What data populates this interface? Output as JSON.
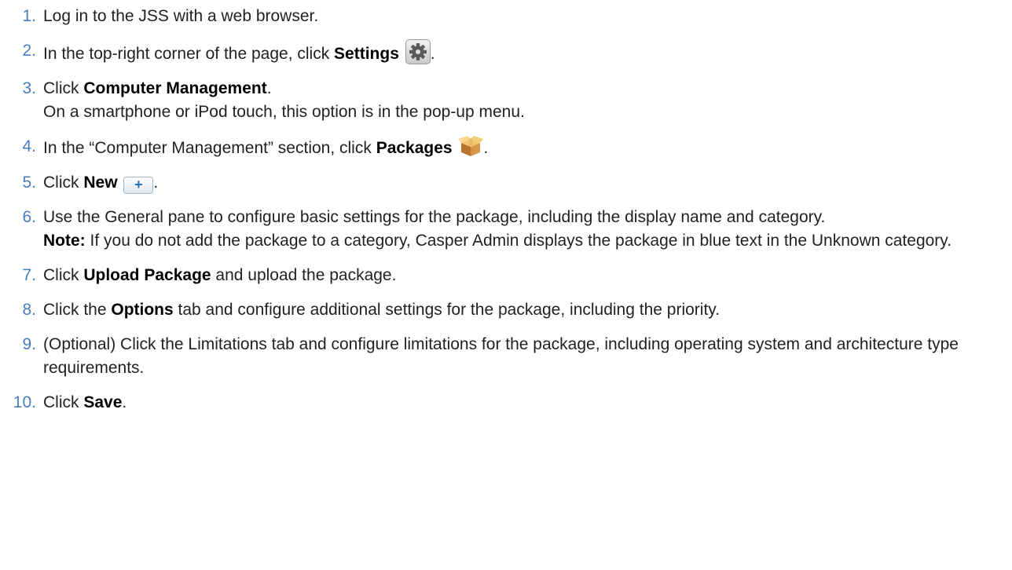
{
  "steps": [
    {
      "num": "1.",
      "parts": {
        "a": "Log in to the JSS with a web browser."
      }
    },
    {
      "num": "2.",
      "parts": {
        "a": "In the top-right corner of the page, click ",
        "b": "Settings",
        "c": "."
      },
      "icon": "gear-icon"
    },
    {
      "num": "3.",
      "parts": {
        "a": "Click ",
        "b": "Computer Management",
        "c": ".",
        "d": "On a smartphone or iPod touch, this option is in the pop-up menu."
      }
    },
    {
      "num": "4.",
      "parts": {
        "a": "In the “Computer Management” section, click ",
        "b": "Packages",
        "c": "."
      },
      "icon": "package-icon"
    },
    {
      "num": "5.",
      "parts": {
        "a": "Click ",
        "b": "New",
        "c": "."
      },
      "icon": "plus-icon",
      "icon_text": "+"
    },
    {
      "num": "6.",
      "parts": {
        "a": "Use the General pane to configure basic settings for the package, including the display name and category.",
        "b": "Note:",
        "c": " If you do not add the package to a category, Casper Admin displays the package in blue text in the Unknown category."
      }
    },
    {
      "num": "7.",
      "parts": {
        "a": "Click ",
        "b": "Upload Package",
        "c": " and upload the package."
      }
    },
    {
      "num": "8.",
      "parts": {
        "a": "Click the ",
        "b": "Options",
        "c": " tab and configure additional settings for the package, including the priority."
      }
    },
    {
      "num": "9.",
      "parts": {
        "a": "(Optional) Click the Limitations tab and configure limitations for the package, including operating system and architecture type requirements."
      }
    },
    {
      "num": "10.",
      "parts": {
        "a": "Click ",
        "b": "Save",
        "c": "."
      }
    }
  ],
  "colors": {
    "number": "#4a7dbe",
    "text": "#231f20"
  }
}
